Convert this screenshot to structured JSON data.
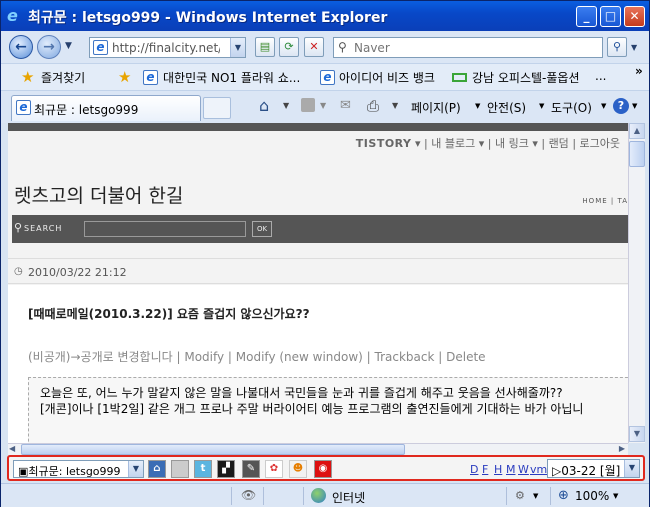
{
  "window": {
    "title": "최규문 : letsgo999 - Windows Internet Explorer"
  },
  "nav": {
    "url": "http://finalcity.net/tv",
    "search_placeholder": "Naver"
  },
  "favorites": {
    "label": "즐겨찾기",
    "items": [
      "대한민국 NO1 플라워 쇼...",
      "아이디어 비즈 뱅크",
      "강남 오피스텔-풀옵션",
      "..."
    ]
  },
  "tab": {
    "title": "최규문 : letsgo999"
  },
  "commandbar": {
    "page": "페이지(P)",
    "safety": "안전(S)",
    "tools": "도구(O)",
    "help": "?"
  },
  "page": {
    "tistory": "TISTORY",
    "tistory_links": [
      "내 블로그",
      "내 링크",
      "랜덤",
      "로그아웃"
    ],
    "blog_title": "렛츠고의 더불어 한길",
    "home_nav": "HOME | TA",
    "search_label": "SEARCH",
    "search_ok": "OK",
    "date": "2010/03/22 21:12",
    "post_title": "[때때로메일(2010.3.22)] 요즘 즐겁지 않으신가요??",
    "post_meta": "(비공개)→공개로 변경합니다 | Modify | Modify (new window) | Trackback | Delete",
    "quote_line1": "오늘은 또, 어느 누가 말같지 않은 말을 나불대서 국민들을 눈과 귀를 즐겁게 해주고 웃음을 선사해줄까??",
    "quote_line2": "[개콘]이나 [1박2일] 같은 개그 프로나 주말 버라이어티 예능 프로그램의 출연진들에게 기대하는 바가 아닙니"
  },
  "bottombar": {
    "select_value": "▣최규문: letsgo999",
    "links": [
      "D",
      "F",
      "H",
      "M",
      "W",
      "vm"
    ],
    "date_value": "▷03-22 [월]"
  },
  "status": {
    "zone": "인터넷",
    "zoom": "100%"
  }
}
